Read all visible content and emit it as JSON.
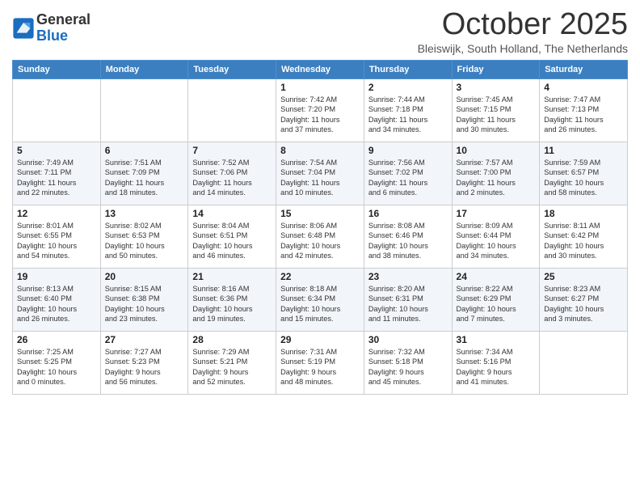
{
  "header": {
    "logo_general": "General",
    "logo_blue": "Blue",
    "month_title": "October 2025",
    "location": "Bleiswijk, South Holland, The Netherlands"
  },
  "weekdays": [
    "Sunday",
    "Monday",
    "Tuesday",
    "Wednesday",
    "Thursday",
    "Friday",
    "Saturday"
  ],
  "weeks": [
    [
      {
        "day": "",
        "info": ""
      },
      {
        "day": "",
        "info": ""
      },
      {
        "day": "",
        "info": ""
      },
      {
        "day": "1",
        "info": "Sunrise: 7:42 AM\nSunset: 7:20 PM\nDaylight: 11 hours\nand 37 minutes."
      },
      {
        "day": "2",
        "info": "Sunrise: 7:44 AM\nSunset: 7:18 PM\nDaylight: 11 hours\nand 34 minutes."
      },
      {
        "day": "3",
        "info": "Sunrise: 7:45 AM\nSunset: 7:15 PM\nDaylight: 11 hours\nand 30 minutes."
      },
      {
        "day": "4",
        "info": "Sunrise: 7:47 AM\nSunset: 7:13 PM\nDaylight: 11 hours\nand 26 minutes."
      }
    ],
    [
      {
        "day": "5",
        "info": "Sunrise: 7:49 AM\nSunset: 7:11 PM\nDaylight: 11 hours\nand 22 minutes."
      },
      {
        "day": "6",
        "info": "Sunrise: 7:51 AM\nSunset: 7:09 PM\nDaylight: 11 hours\nand 18 minutes."
      },
      {
        "day": "7",
        "info": "Sunrise: 7:52 AM\nSunset: 7:06 PM\nDaylight: 11 hours\nand 14 minutes."
      },
      {
        "day": "8",
        "info": "Sunrise: 7:54 AM\nSunset: 7:04 PM\nDaylight: 11 hours\nand 10 minutes."
      },
      {
        "day": "9",
        "info": "Sunrise: 7:56 AM\nSunset: 7:02 PM\nDaylight: 11 hours\nand 6 minutes."
      },
      {
        "day": "10",
        "info": "Sunrise: 7:57 AM\nSunset: 7:00 PM\nDaylight: 11 hours\nand 2 minutes."
      },
      {
        "day": "11",
        "info": "Sunrise: 7:59 AM\nSunset: 6:57 PM\nDaylight: 10 hours\nand 58 minutes."
      }
    ],
    [
      {
        "day": "12",
        "info": "Sunrise: 8:01 AM\nSunset: 6:55 PM\nDaylight: 10 hours\nand 54 minutes."
      },
      {
        "day": "13",
        "info": "Sunrise: 8:02 AM\nSunset: 6:53 PM\nDaylight: 10 hours\nand 50 minutes."
      },
      {
        "day": "14",
        "info": "Sunrise: 8:04 AM\nSunset: 6:51 PM\nDaylight: 10 hours\nand 46 minutes."
      },
      {
        "day": "15",
        "info": "Sunrise: 8:06 AM\nSunset: 6:48 PM\nDaylight: 10 hours\nand 42 minutes."
      },
      {
        "day": "16",
        "info": "Sunrise: 8:08 AM\nSunset: 6:46 PM\nDaylight: 10 hours\nand 38 minutes."
      },
      {
        "day": "17",
        "info": "Sunrise: 8:09 AM\nSunset: 6:44 PM\nDaylight: 10 hours\nand 34 minutes."
      },
      {
        "day": "18",
        "info": "Sunrise: 8:11 AM\nSunset: 6:42 PM\nDaylight: 10 hours\nand 30 minutes."
      }
    ],
    [
      {
        "day": "19",
        "info": "Sunrise: 8:13 AM\nSunset: 6:40 PM\nDaylight: 10 hours\nand 26 minutes."
      },
      {
        "day": "20",
        "info": "Sunrise: 8:15 AM\nSunset: 6:38 PM\nDaylight: 10 hours\nand 23 minutes."
      },
      {
        "day": "21",
        "info": "Sunrise: 8:16 AM\nSunset: 6:36 PM\nDaylight: 10 hours\nand 19 minutes."
      },
      {
        "day": "22",
        "info": "Sunrise: 8:18 AM\nSunset: 6:34 PM\nDaylight: 10 hours\nand 15 minutes."
      },
      {
        "day": "23",
        "info": "Sunrise: 8:20 AM\nSunset: 6:31 PM\nDaylight: 10 hours\nand 11 minutes."
      },
      {
        "day": "24",
        "info": "Sunrise: 8:22 AM\nSunset: 6:29 PM\nDaylight: 10 hours\nand 7 minutes."
      },
      {
        "day": "25",
        "info": "Sunrise: 8:23 AM\nSunset: 6:27 PM\nDaylight: 10 hours\nand 3 minutes."
      }
    ],
    [
      {
        "day": "26",
        "info": "Sunrise: 7:25 AM\nSunset: 5:25 PM\nDaylight: 10 hours\nand 0 minutes."
      },
      {
        "day": "27",
        "info": "Sunrise: 7:27 AM\nSunset: 5:23 PM\nDaylight: 9 hours\nand 56 minutes."
      },
      {
        "day": "28",
        "info": "Sunrise: 7:29 AM\nSunset: 5:21 PM\nDaylight: 9 hours\nand 52 minutes."
      },
      {
        "day": "29",
        "info": "Sunrise: 7:31 AM\nSunset: 5:19 PM\nDaylight: 9 hours\nand 48 minutes."
      },
      {
        "day": "30",
        "info": "Sunrise: 7:32 AM\nSunset: 5:18 PM\nDaylight: 9 hours\nand 45 minutes."
      },
      {
        "day": "31",
        "info": "Sunrise: 7:34 AM\nSunset: 5:16 PM\nDaylight: 9 hours\nand 41 minutes."
      },
      {
        "day": "",
        "info": ""
      }
    ]
  ]
}
